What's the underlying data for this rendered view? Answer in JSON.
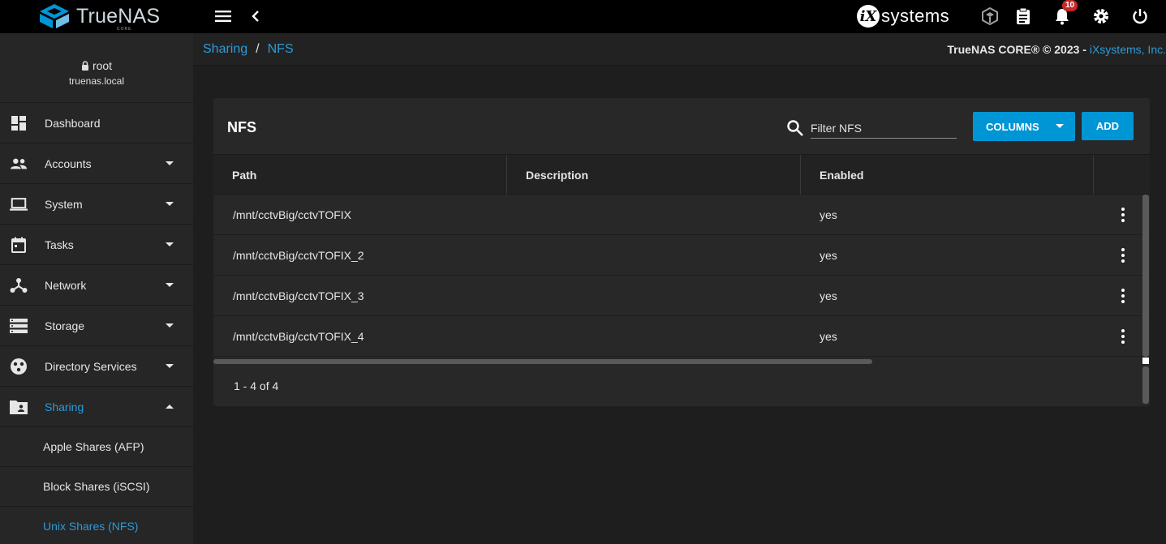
{
  "topbar": {
    "brand": "TrueNAS",
    "brand_sub": "CORE",
    "vendor_badge": "iX",
    "vendor_text": "systems",
    "notification_count": "10",
    "icons": [
      "menu-icon",
      "chevron-left-icon",
      "truecommand-icon",
      "task-manager-icon",
      "bell-icon",
      "gear-icon",
      "power-icon"
    ]
  },
  "user": {
    "name": "root",
    "host": "truenas.local"
  },
  "sidebar": {
    "items": [
      {
        "label": "Dashboard",
        "icon": "dashboard-icon"
      },
      {
        "label": "Accounts",
        "icon": "people-icon"
      },
      {
        "label": "System",
        "icon": "laptop-icon"
      },
      {
        "label": "Tasks",
        "icon": "calendar-icon"
      },
      {
        "label": "Network",
        "icon": "network-icon"
      },
      {
        "label": "Storage",
        "icon": "storage-icon"
      },
      {
        "label": "Directory Services",
        "icon": "directory-icon"
      },
      {
        "label": "Sharing",
        "icon": "shared-folder-icon"
      }
    ],
    "subitems": [
      {
        "label": "Apple Shares (AFP)"
      },
      {
        "label": "Block Shares (iSCSI)"
      },
      {
        "label": "Unix Shares (NFS)"
      }
    ]
  },
  "breadcrumb": {
    "parent": "Sharing",
    "separator": "/",
    "current": "NFS"
  },
  "copyright": {
    "text": "TrueNAS CORE® © 2023 - ",
    "link": "iXsystems, Inc."
  },
  "card": {
    "title": "NFS",
    "filter_placeholder": "Filter NFS",
    "columns_label": "COLUMNS",
    "add_label": "ADD",
    "headers": [
      "Path",
      "Description",
      "Enabled"
    ],
    "rows": [
      {
        "path": "/mnt/cctvBig/cctvTOFIX",
        "description": "",
        "enabled": "yes"
      },
      {
        "path": "/mnt/cctvBig/cctvTOFIX_2",
        "description": "",
        "enabled": "yes"
      },
      {
        "path": "/mnt/cctvBig/cctvTOFIX_3",
        "description": "",
        "enabled": "yes"
      },
      {
        "path": "/mnt/cctvBig/cctvTOFIX_4",
        "description": "",
        "enabled": "yes"
      }
    ],
    "paging": "1 - 4 of 4"
  },
  "colors": {
    "accent": "#0095d5",
    "link": "#2e9ad6",
    "badge": "#c62828"
  }
}
